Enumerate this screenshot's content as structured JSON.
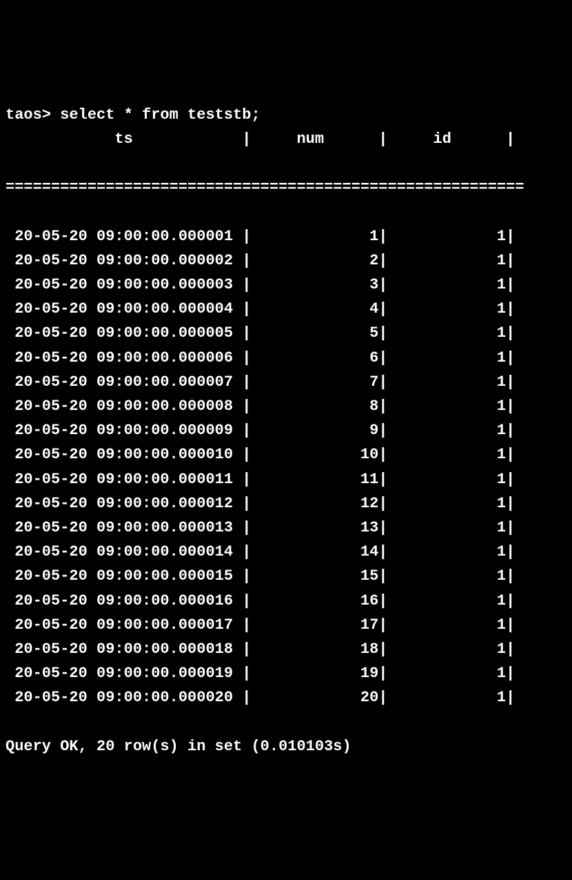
{
  "prompt": "taos>",
  "query": "select * from teststb;",
  "columns": [
    "ts",
    "num",
    "id"
  ],
  "col_widths": {
    "ts": 26,
    "num": 14,
    "id": 13
  },
  "rows": [
    {
      "ts": "20-05-20 09:00:00.000001",
      "num": "1",
      "id": "1"
    },
    {
      "ts": "20-05-20 09:00:00.000002",
      "num": "2",
      "id": "1"
    },
    {
      "ts": "20-05-20 09:00:00.000003",
      "num": "3",
      "id": "1"
    },
    {
      "ts": "20-05-20 09:00:00.000004",
      "num": "4",
      "id": "1"
    },
    {
      "ts": "20-05-20 09:00:00.000005",
      "num": "5",
      "id": "1"
    },
    {
      "ts": "20-05-20 09:00:00.000006",
      "num": "6",
      "id": "1"
    },
    {
      "ts": "20-05-20 09:00:00.000007",
      "num": "7",
      "id": "1"
    },
    {
      "ts": "20-05-20 09:00:00.000008",
      "num": "8",
      "id": "1"
    },
    {
      "ts": "20-05-20 09:00:00.000009",
      "num": "9",
      "id": "1"
    },
    {
      "ts": "20-05-20 09:00:00.000010",
      "num": "10",
      "id": "1"
    },
    {
      "ts": "20-05-20 09:00:00.000011",
      "num": "11",
      "id": "1"
    },
    {
      "ts": "20-05-20 09:00:00.000012",
      "num": "12",
      "id": "1"
    },
    {
      "ts": "20-05-20 09:00:00.000013",
      "num": "13",
      "id": "1"
    },
    {
      "ts": "20-05-20 09:00:00.000014",
      "num": "14",
      "id": "1"
    },
    {
      "ts": "20-05-20 09:00:00.000015",
      "num": "15",
      "id": "1"
    },
    {
      "ts": "20-05-20 09:00:00.000016",
      "num": "16",
      "id": "1"
    },
    {
      "ts": "20-05-20 09:00:00.000017",
      "num": "17",
      "id": "1"
    },
    {
      "ts": "20-05-20 09:00:00.000018",
      "num": "18",
      "id": "1"
    },
    {
      "ts": "20-05-20 09:00:00.000019",
      "num": "19",
      "id": "1"
    },
    {
      "ts": "20-05-20 09:00:00.000020",
      "num": "20",
      "id": "1"
    }
  ],
  "status": "Query OK, 20 row(s) in set (0.010103s)",
  "divider_width": 57
}
